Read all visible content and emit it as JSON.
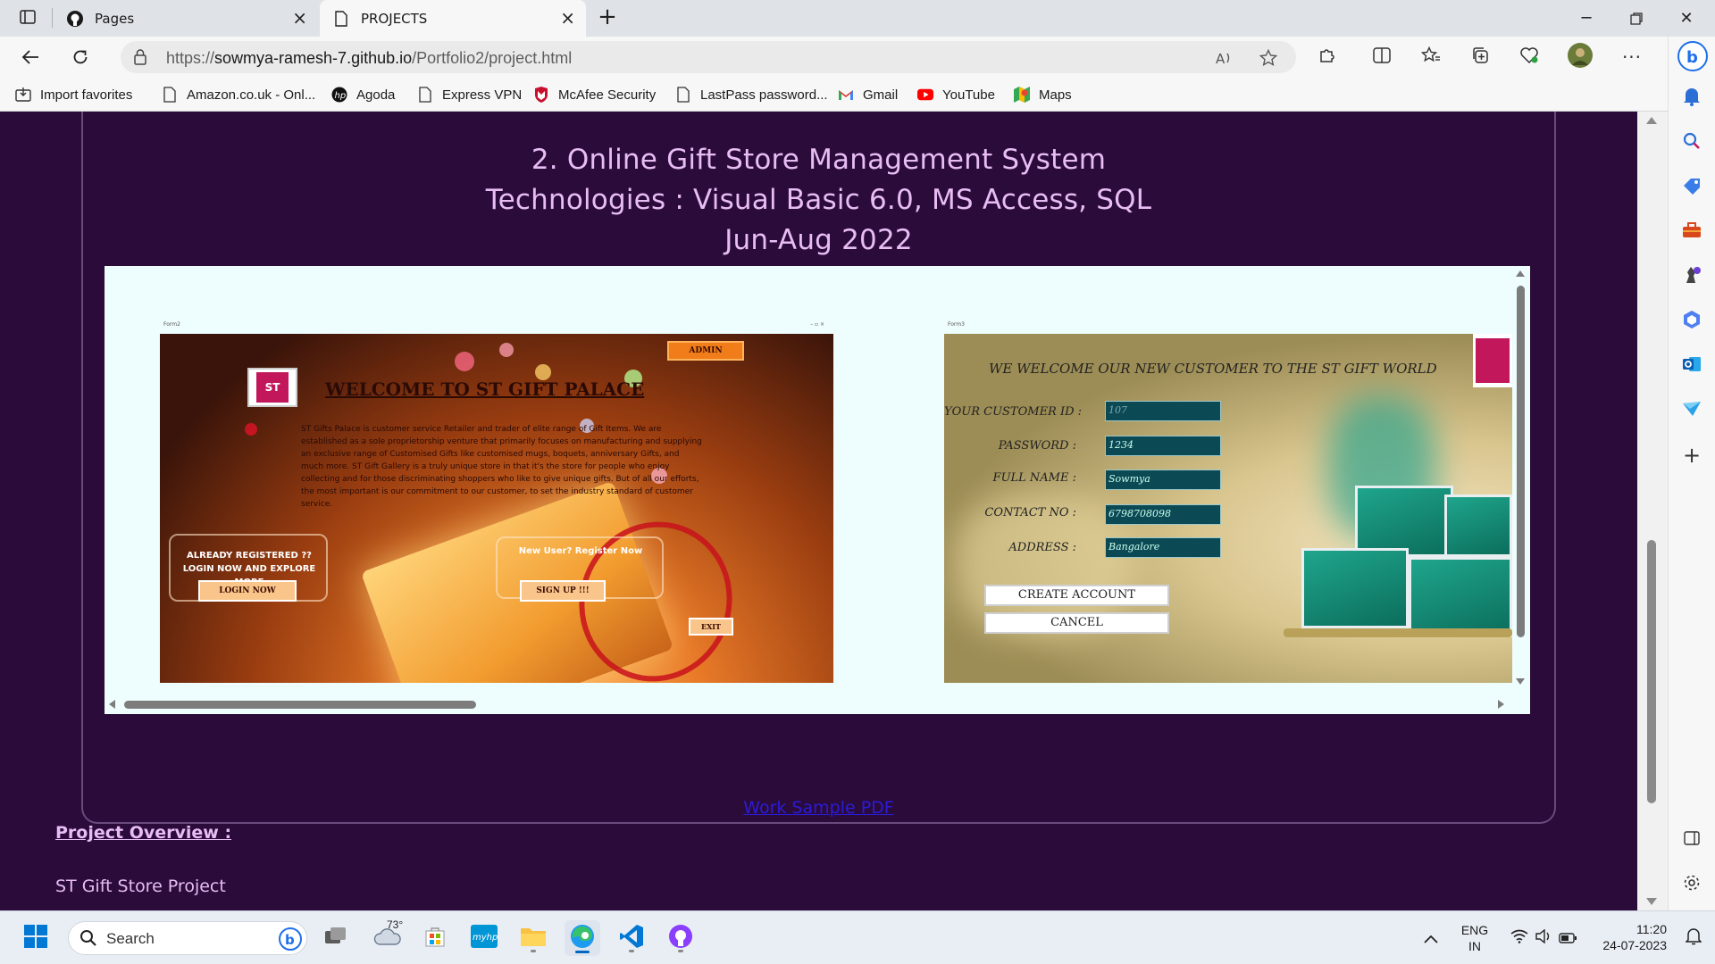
{
  "browser": {
    "tabs": [
      {
        "label": "Pages",
        "icon": "github-icon",
        "active": false
      },
      {
        "label": "PROJECTS",
        "icon": "page-icon",
        "active": true
      }
    ],
    "url": {
      "prefix": "https://",
      "host": "sowmya-ramesh-7.github.io",
      "path": "/Portfolio2/project.html"
    },
    "favorites": [
      {
        "label": "Import favorites",
        "icon": "import-icon"
      },
      {
        "label": "Amazon.co.uk - Onl...",
        "icon": "page-icon"
      },
      {
        "label": "Agoda",
        "icon": "hp-icon"
      },
      {
        "label": "Express VPN",
        "icon": "page-icon"
      },
      {
        "label": "McAfee Security",
        "icon": "mcafee-icon"
      },
      {
        "label": "LastPass password...",
        "icon": "page-icon"
      },
      {
        "label": "Gmail",
        "icon": "gmail-icon"
      },
      {
        "label": "YouTube",
        "icon": "youtube-icon"
      },
      {
        "label": "Maps",
        "icon": "maps-icon"
      }
    ]
  },
  "project": {
    "title": "2. Online Gift Store Management System",
    "technologies": "Technologies : Visual Basic 6.0, MS Access, SQL",
    "dates": "Jun-Aug 2022",
    "screenshot1": {
      "window_title": "Form2",
      "admin_button": "ADMIN",
      "logo_text": "ST",
      "heading": "WELCOME TO ST GIFT PALACE",
      "description": "ST Gifts Palace is customer service Retailer and trader of elite range of  Gift Items. We are established as a sole proprietorship venture that primarily focuses on manufacturing and supplying an exclusive range of Customised Gifts like customised mugs, boquets, anniversary Gifts,  and much more. ST Gift Gallery is a truly unique store in that it's the store for people who enjoy collecting and for those discriminating shoppers who like to give unique gifts. But of all our efforts, the most important is our commitment to our customer, to set the industry standard of customer service.",
      "login_prompt": "ALREADY REGISTERED ?? LOGIN NOW AND EXPLORE MORE",
      "login_button": "LOGIN NOW",
      "signup_prompt": "New User? Register Now",
      "signup_button": "SIGN UP !!!",
      "exit_button": "EXIT"
    },
    "screenshot2": {
      "window_title": "Form3",
      "heading": "WE WELCOME OUR NEW CUSTOMER TO THE ST GIFT WORLD",
      "fields": [
        {
          "label": "YOUR CUSTOMER ID :",
          "value": "107",
          "dim": true
        },
        {
          "label": "PASSWORD :",
          "value": "1234",
          "dim": false
        },
        {
          "label": "FULL NAME :",
          "value": "Sowmya",
          "dim": false
        },
        {
          "label": "CONTACT NO :",
          "value": "6798708098",
          "dim": false
        },
        {
          "label": "ADDRESS :",
          "value": "Bangalore",
          "dim": false
        }
      ],
      "create_button": "CREATE ACCOUNT",
      "cancel_button": "CANCEL"
    },
    "work_sample_link": "Work Sample PDF",
    "overview_heading": "Project Overview :",
    "project_name": "ST Gift Store Project"
  },
  "taskbar": {
    "search_placeholder": "Search",
    "weather_temp": "73°",
    "language": "ENG",
    "region": "IN",
    "time": "11:20",
    "date": "24-07-2023"
  },
  "colors": {
    "page_background": "#2b0b3a",
    "heading_text": "#e7bdf4",
    "link": "#2a1cd6",
    "gallery_background": "#eefdfd"
  }
}
